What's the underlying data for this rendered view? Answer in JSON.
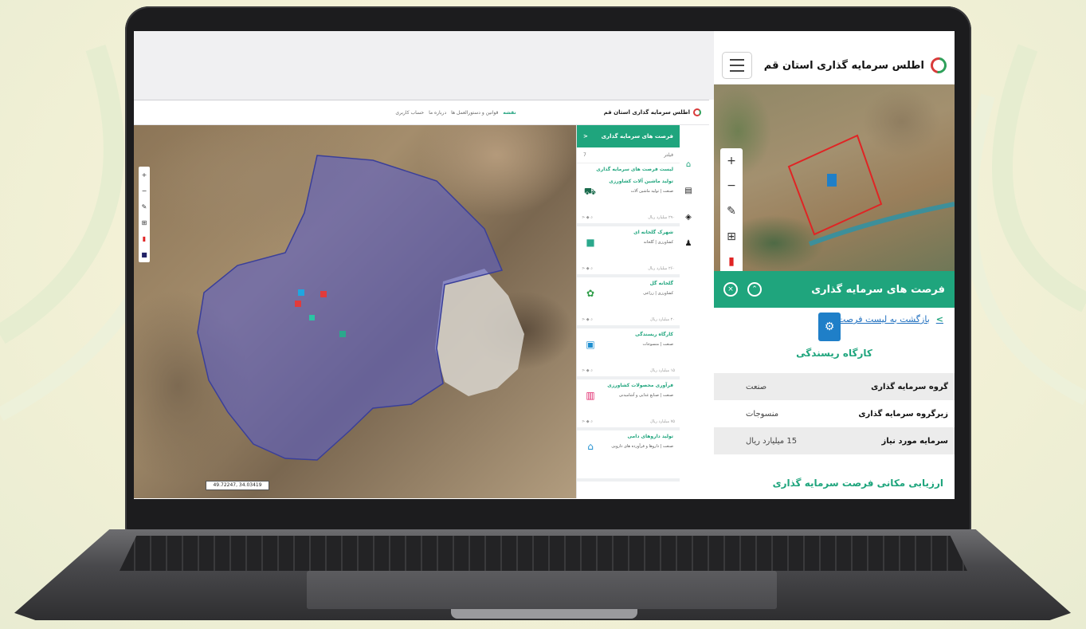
{
  "desktop": {
    "header": {
      "brand": "اطلس سرمایه گذاری استان قم",
      "nav": [
        "نقشه",
        "قوانین و دستورالعمل ها",
        "درباره ما",
        "حساب کاربری"
      ]
    },
    "panel": {
      "title": "فرصت های سرمایه گذاری",
      "filter_label": "فیلتر",
      "filter_count": "7",
      "list_title": "لیست فرصت های سرمایه گذاری",
      "cards": [
        {
          "title": "تولید ماشین آلات کشاورزی",
          "subtitle": "صنعت | تولید ماشین آلات",
          "capital": "۲۹۰ میلیارد ریال"
        },
        {
          "title": "شهرک گلخانه ای",
          "subtitle": "کشاورزی | گلخانه",
          "capital": "۲۶۰ میلیارد ریال"
        },
        {
          "title": "گلخانه گل",
          "subtitle": "کشاورزی | زراعی",
          "capital": "۲۰ میلیارد ریال"
        },
        {
          "title": "کارگاه ریسندگی",
          "subtitle": "صنعت | منسوجات",
          "capital": "۱۵ میلیارد ریال"
        },
        {
          "title": "فرآوری محصولات کشاورزی",
          "subtitle": "صنعت | صنایع غذایی و آشامیدنی",
          "capital": "۷۵ میلیارد ریال"
        },
        {
          "title": "تولید داروهای دامی",
          "subtitle": "صنعت | داروها و فرآورده های دارویی",
          "capital": ""
        }
      ]
    },
    "map": {
      "coordinate_readout": "49.72247, 34.03419"
    }
  },
  "mobile": {
    "brand": "اطلس سرمایه گذاری استان قم",
    "title_bar": "فرصت های سرمایه گذاری",
    "back_link": "بازگشت به لیست فرصت ها",
    "item_name": "کارگاه ریسندگی",
    "details": [
      {
        "key": "گروه سرمایه گذاری",
        "value": "صنعت"
      },
      {
        "key": "زیرگروه سرمایه گذاری",
        "value": "منسوجات"
      },
      {
        "key": "سرمایه مورد نیاز",
        "value": "15 میلیارد ریال"
      }
    ],
    "section_title": "ارزیابی مکانی فرصت سرمایه گذاری"
  },
  "colors": {
    "accent": "#1fa57d",
    "boundary": "#e02424",
    "polygon": "#5b5fc7"
  }
}
